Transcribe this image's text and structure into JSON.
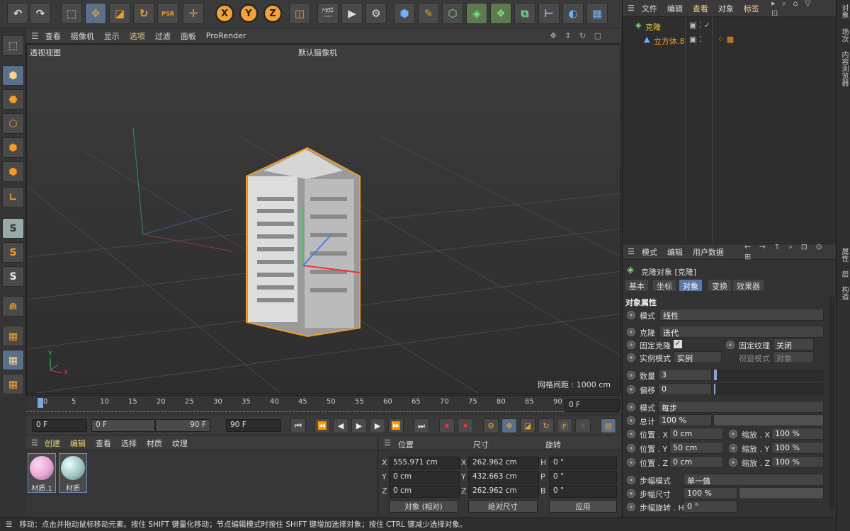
{
  "viewport": {
    "menu": [
      "查看",
      "摄像机",
      "显示",
      "选项",
      "过滤",
      "面板",
      "ProRender"
    ],
    "title": "透视视图",
    "camera": "默认摄像机",
    "grid_spacing": "网格间距 : 1000 cm"
  },
  "toolbar": {
    "axis_x": "X",
    "axis_y": "Y",
    "axis_z": "Z",
    "psr": "PSR"
  },
  "timeline": {
    "ticks": [
      "0",
      "5",
      "10",
      "15",
      "20",
      "25",
      "30",
      "35",
      "40",
      "45",
      "50",
      "55",
      "60",
      "65",
      "70",
      "75",
      "80",
      "85",
      "90"
    ],
    "current_frame": "0 F",
    "start": "0 F",
    "range_start": "0 F",
    "range_end": "90 F",
    "end": "90 F"
  },
  "materials": {
    "menu": [
      "创建",
      "编辑",
      "查看",
      "选择",
      "材质",
      "纹理"
    ],
    "items": [
      {
        "name": "材质.1",
        "color": "#e6a4d6"
      },
      {
        "name": "材质",
        "color": "#9fc6c4"
      }
    ]
  },
  "coords": {
    "headers": {
      "position": "位置",
      "size": "尺寸",
      "rotation": "旋转"
    },
    "pos": {
      "x": "555.971 cm",
      "y": "0 cm",
      "z": "0 cm"
    },
    "size": {
      "x": "262.962 cm",
      "y": "432.663 cm",
      "z": "262.962 cm"
    },
    "rot": {
      "h": "0 °",
      "p": "0 °",
      "b": "0 °"
    },
    "mode": "对象 (相对)",
    "size_mode": "绝对尺寸",
    "apply": "应用",
    "labels": {
      "x": "X",
      "y": "Y",
      "z": "Z",
      "h": "H",
      "p": "P",
      "b": "B"
    }
  },
  "status": "移动：点击并拖动鼠标移动元素。按住 SHIFT 键量化移动；节点编辑模式时按住 SHIFT 键增加选择对象；按住 CTRL 键减少选择对象。",
  "object_manager": {
    "menu": [
      "文件",
      "编辑",
      "查看",
      "对象",
      "标签"
    ],
    "objects": [
      {
        "name": "克隆",
        "color": "#f0c43a"
      },
      {
        "name": "立方体.8",
        "color": "#f39c28"
      }
    ]
  },
  "side_tabs": {
    "top": [
      "对象",
      "场次",
      "内容浏览器"
    ],
    "bottom": [
      "属性",
      "层",
      "构造"
    ]
  },
  "attributes": {
    "menu": [
      "模式",
      "编辑",
      "用户数据"
    ],
    "title": "克隆对象 [克隆]",
    "tabs": [
      "基本",
      "坐标",
      "对象",
      "变换",
      "效果器"
    ],
    "section": "对象属性",
    "mode_label": "模式",
    "mode_value": "线性",
    "clone_label": "克隆",
    "clone_value": "迭代",
    "fix_clone_label": "固定克隆",
    "fix_texture_label": "固定纹理",
    "fix_texture_value": "关闭",
    "instance_label": "实例模式",
    "instance_value": "实例",
    "viewport_label": "视窗模式",
    "viewport_value": "对象",
    "count_label": "数量",
    "count_value": "3",
    "offset_label": "偏移",
    "offset_value": "0",
    "mode2_label": "模式",
    "mode2_value": "每步",
    "total_label": "总计",
    "total_value": "100 %",
    "pos_x_label": "位置 . X",
    "pos_x": "0 cm",
    "pos_y_label": "位置 . Y",
    "pos_y": "50 cm",
    "pos_z_label": "位置 . Z",
    "pos_z": "0 cm",
    "scale_x_label": "缩放 . X",
    "scale_x": "100 %",
    "scale_y_label": "缩放 . Y",
    "scale_y": "100 %",
    "scale_z_label": "缩放 . Z",
    "scale_z": "100 %",
    "step_mode_label": "步幅模式",
    "step_mode_value": "单一值",
    "step_size_label": "步幅尺寸",
    "step_size_value": "100 %",
    "step_rot_label": "步幅旋转 . H",
    "step_rot_value": "0 °"
  }
}
